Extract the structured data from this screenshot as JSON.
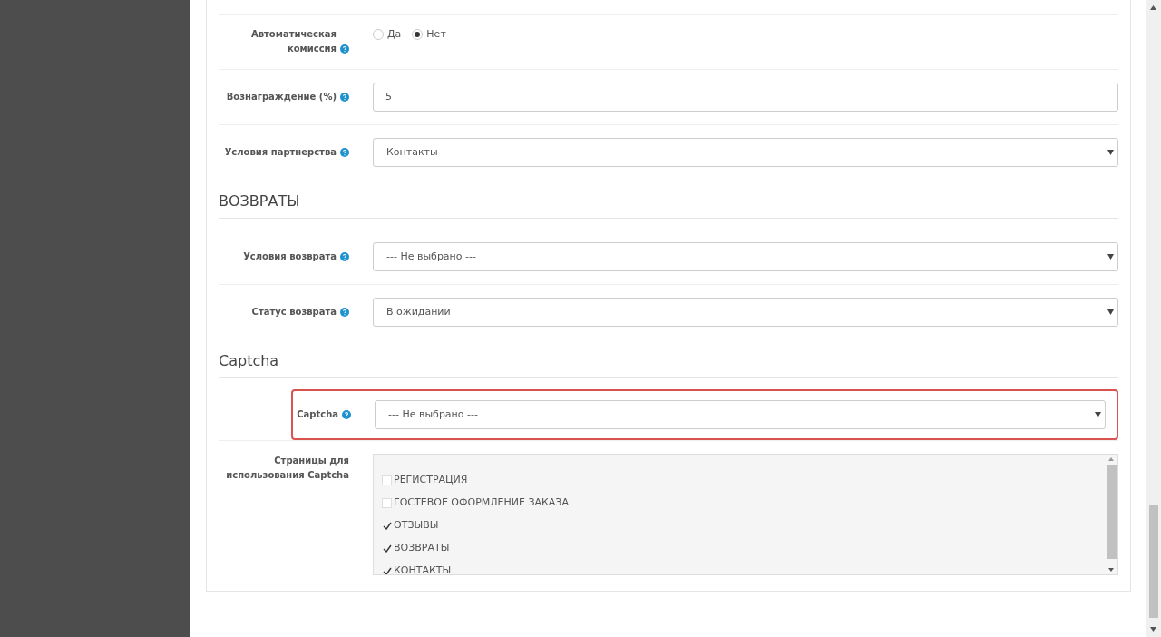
{
  "sections": [
    {
      "rows": [
        {
          "kind": "radio",
          "label": "Автоматическая комиссия",
          "help": true,
          "highlighted": false,
          "options": [
            {
              "label": "Да",
              "selected": false
            },
            {
              "label": "Нет",
              "selected": true
            }
          ]
        },
        {
          "kind": "text",
          "label": "Вознаграждение (%)",
          "help": true,
          "highlighted": false,
          "value": "5"
        },
        {
          "kind": "select",
          "label": "Условия партнерства",
          "help": true,
          "highlighted": false,
          "value": "Контакты"
        }
      ]
    },
    {
      "heading": "ВОЗВРАТЫ",
      "rows": [
        {
          "kind": "select",
          "label": "Условия возврата",
          "help": true,
          "highlighted": false,
          "value": "--- Не выбрано ---"
        },
        {
          "kind": "select",
          "label": "Статус возврата",
          "help": true,
          "highlighted": false,
          "value": "В ожидании"
        }
      ]
    },
    {
      "heading": "Captcha",
      "rows": [
        {
          "kind": "select",
          "label": "Captcha",
          "help": true,
          "highlighted": true,
          "value": "--- Не выбрано ---"
        },
        {
          "kind": "checklist",
          "label": "Страницы для использования Captcha",
          "help": false,
          "highlighted": false,
          "items": [
            {
              "label": "РЕГИСТРАЦИЯ",
              "checked": false
            },
            {
              "label": "ГОСТЕВОЕ ОФОРМЛЕНИЕ ЗАКАЗА",
              "checked": false
            },
            {
              "label": "ОТЗЫВЫ",
              "checked": true
            },
            {
              "label": "ВОЗВРАТЫ",
              "checked": true
            },
            {
              "label": "КОНТАКТЫ",
              "checked": true
            }
          ]
        }
      ]
    }
  ]
}
